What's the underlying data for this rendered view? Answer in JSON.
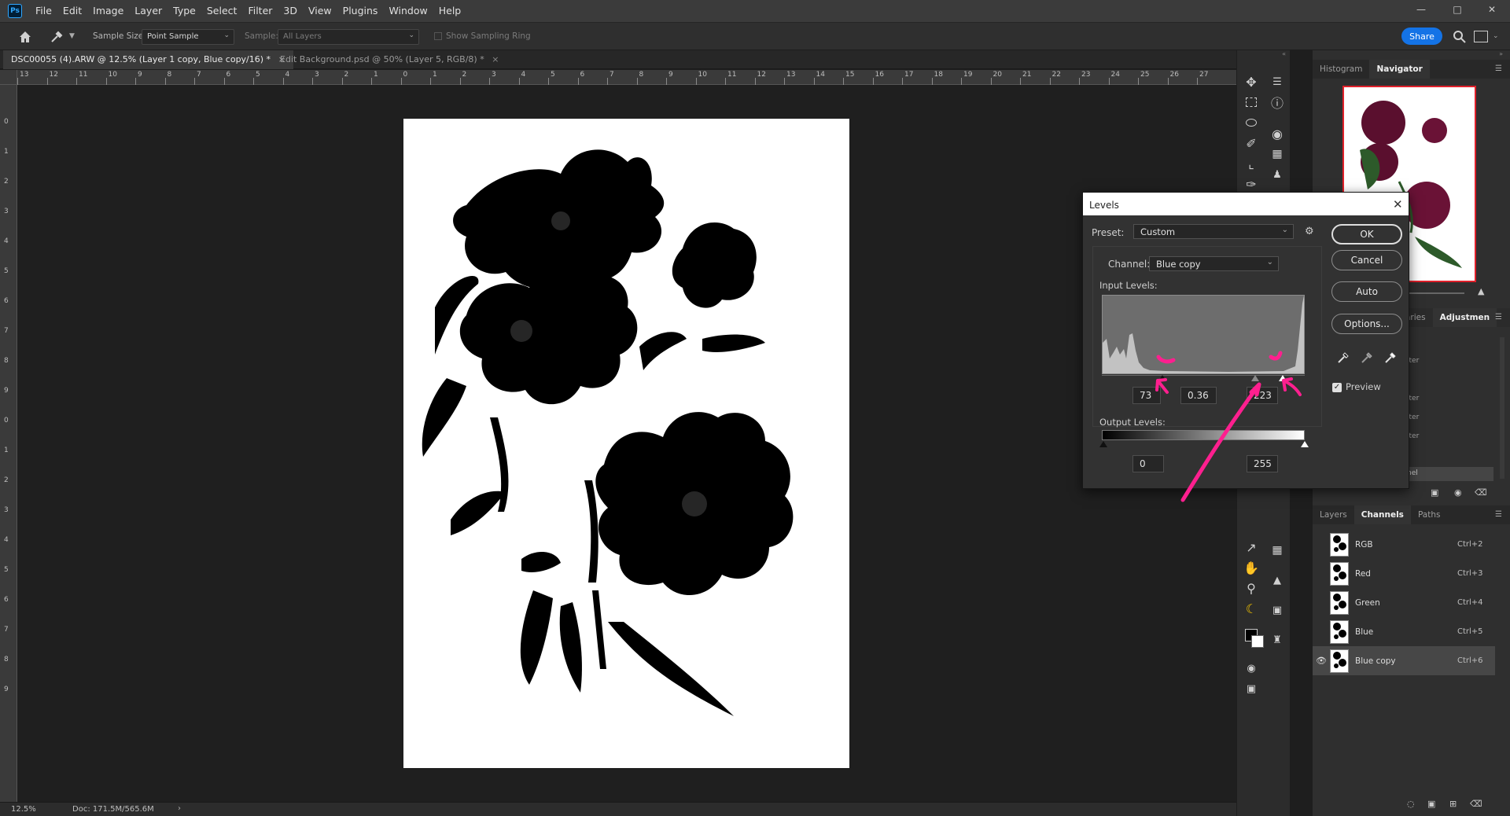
{
  "menubar": {
    "logo": "Ps",
    "items": [
      "File",
      "Edit",
      "Image",
      "Layer",
      "Type",
      "Select",
      "Filter",
      "3D",
      "View",
      "Plugins",
      "Window",
      "Help"
    ]
  },
  "options": {
    "sample_size_label": "Sample Size:",
    "sample_size_value": "Point Sample",
    "sample_label": "Sample:",
    "sample_value": "All Layers",
    "sampling_ring_label": "Show Sampling Ring",
    "share_label": "Share"
  },
  "tabs": [
    {
      "label": "DSC00055 (4).ARW @ 12.5% (Layer 1 copy, Blue copy/16) *",
      "active": true
    },
    {
      "label": "Edit Background.psd @ 50% (Layer 5, RGB/8) *",
      "active": false
    }
  ],
  "hruler_numbers": [
    "13",
    "12",
    "11",
    "10",
    "9",
    "8",
    "7",
    "6",
    "5",
    "4",
    "3",
    "2",
    "1",
    "0",
    "1",
    "2",
    "3",
    "4",
    "5",
    "6",
    "7",
    "8",
    "9",
    "10",
    "11",
    "12",
    "13",
    "14",
    "15",
    "16",
    "17",
    "18",
    "19",
    "20",
    "21",
    "22",
    "23",
    "24",
    "25",
    "26",
    "27"
  ],
  "vruler_numbers": [
    "0",
    "1",
    "2",
    "3",
    "4",
    "5",
    "6",
    "7",
    "8",
    "9",
    "0",
    "1",
    "2",
    "3",
    "4",
    "5",
    "6",
    "7",
    "8",
    "9"
  ],
  "status": {
    "zoom": "12.5%",
    "doc_info": "Doc: 171.5M/565.6M"
  },
  "panels": {
    "top_tabs": [
      "Histogram",
      "Navigator"
    ],
    "mid_tabs": [
      "aries",
      "Adjustmen"
    ],
    "mid_items": [
      "lter",
      "lter",
      "lter",
      "lter",
      "nel"
    ],
    "bottom_tabs": [
      "Layers",
      "Channels",
      "Paths"
    ],
    "channels": [
      {
        "name": "RGB",
        "shortcut": "Ctrl+2",
        "visible": false,
        "selected": false
      },
      {
        "name": "Red",
        "shortcut": "Ctrl+3",
        "visible": false,
        "selected": false
      },
      {
        "name": "Green",
        "shortcut": "Ctrl+4",
        "visible": false,
        "selected": false
      },
      {
        "name": "Blue",
        "shortcut": "Ctrl+5",
        "visible": false,
        "selected": false
      },
      {
        "name": "Blue copy",
        "shortcut": "Ctrl+6",
        "visible": true,
        "selected": true
      }
    ]
  },
  "levels": {
    "title": "Levels",
    "preset_label": "Preset:",
    "preset_value": "Custom",
    "channel_label": "Channel:",
    "channel_value": "Blue copy",
    "input_label": "Input Levels:",
    "input_black": "73",
    "input_gamma": "0.36",
    "input_white": "223",
    "output_label": "Output Levels:",
    "output_black": "0",
    "output_white": "255",
    "buttons": {
      "ok": "OK",
      "cancel": "Cancel",
      "auto": "Auto",
      "options": "Options..."
    },
    "preview_label": "Preview",
    "preview_checked": true
  },
  "colors": {
    "accent": "#1473e6",
    "annotation": "#ff1f8f",
    "dialog_bg": "#323232"
  },
  "icons": [
    "home-icon",
    "eyedropper-icon",
    "move-icon",
    "marquee-icon",
    "lasso-icon",
    "quick-select-icon",
    "crop-icon",
    "eyedropper-tool-icon",
    "hand-icon",
    "zoom-icon",
    "search-icon",
    "settings-gear-icon",
    "close-icon",
    "eye-icon"
  ]
}
